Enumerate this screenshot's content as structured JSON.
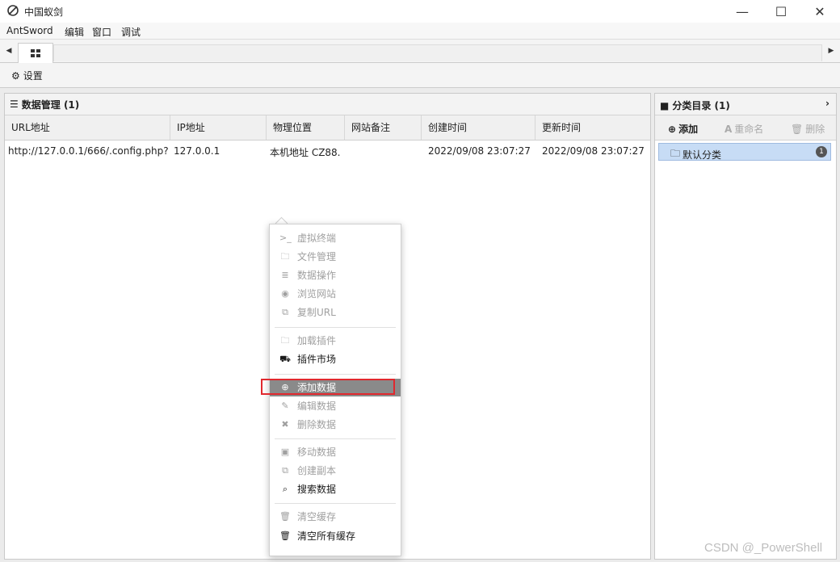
{
  "window": {
    "title": "中国蚁剑",
    "controls": [
      "—",
      "☐",
      "✕"
    ]
  },
  "menu": [
    "AntSword",
    "编辑",
    "窗口",
    "调试"
  ],
  "toolbar": {
    "settings_label": "设置"
  },
  "data_panel": {
    "title": "数据管理 (1)",
    "columns": [
      "URL地址",
      "IP地址",
      "物理位置",
      "网站备注",
      "创建时间",
      "更新时间"
    ],
    "rows": [
      [
        "http://127.0.0.1/666/.config.php?",
        "127.0.0.1",
        "本机地址 CZ88.",
        "",
        "2022/09/08 23:07:27",
        "2022/09/08 23:07:27"
      ]
    ]
  },
  "category_panel": {
    "title": "分类目录 (1)",
    "add_label": "添加",
    "rename_label": "重命名",
    "delete_label": "删除",
    "items": [
      {
        "label": "默认分类",
        "count": "1"
      }
    ]
  },
  "context_menu": {
    "groups": [
      [
        {
          "label": "虚拟终端",
          "icon": "terminal-icon",
          "state": "disabled"
        },
        {
          "label": "文件管理",
          "icon": "folder-icon",
          "state": "disabled"
        },
        {
          "label": "数据操作",
          "icon": "database-icon",
          "state": "disabled"
        },
        {
          "label": "浏览网站",
          "icon": "browser-icon",
          "state": "disabled"
        },
        {
          "label": "复制URL",
          "icon": "copy-icon",
          "state": "disabled"
        }
      ],
      [
        {
          "label": "加载插件",
          "icon": "folder-icon",
          "state": "disabled"
        },
        {
          "label": "插件市场",
          "icon": "cart-icon",
          "state": "enabled"
        }
      ],
      [
        {
          "label": "添加数据",
          "icon": "plus-circle-icon",
          "state": "highlight"
        },
        {
          "label": "编辑数据",
          "icon": "edit-icon",
          "state": "disabled"
        },
        {
          "label": "删除数据",
          "icon": "close-icon",
          "state": "disabled"
        }
      ],
      [
        {
          "label": "移动数据",
          "icon": "move-icon",
          "state": "disabled"
        },
        {
          "label": "创建副本",
          "icon": "copy-icon",
          "state": "disabled"
        },
        {
          "label": "搜索数据",
          "icon": "search-icon",
          "state": "enabled"
        }
      ],
      [
        {
          "label": "清空缓存",
          "icon": "trash-icon",
          "state": "disabled"
        },
        {
          "label": "清空所有缓存",
          "icon": "trash-icon",
          "state": "enabled"
        }
      ]
    ]
  },
  "watermark": "CSDN @_PowerShell",
  "colors": {
    "highlight": "#8a8a8a",
    "selection": "#c7dcf5",
    "annotation": "#e0282e"
  }
}
